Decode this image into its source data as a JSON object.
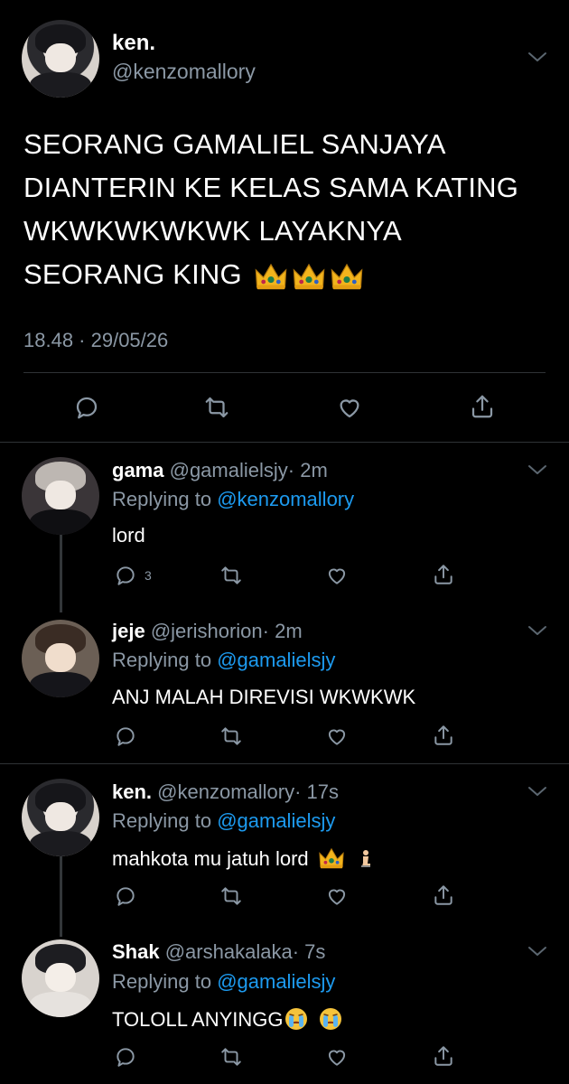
{
  "main": {
    "name": "ken.",
    "handle": "@kenzomallory",
    "text": "SEORANG GAMALIEL SANJAYA DIANTERIN KE KELAS SAMA KATING WKWKWKWKWK LAYAKNYA SEORANG KING",
    "emoji": [
      "crown",
      "crown",
      "crown"
    ],
    "time": "18.48 · 29/05/26"
  },
  "replies": [
    {
      "name": "gama",
      "handle": "@gamalielsjy",
      "age": "· 2m",
      "replying_prefix": "Replying to ",
      "replying_to": "@kenzomallory",
      "text": "lord",
      "reply_count": "3"
    },
    {
      "name": "jeje",
      "handle": "@jerishorion",
      "age": "· 2m",
      "replying_prefix": "Replying to ",
      "replying_to": "@gamalielsjy",
      "text": "ANJ MALAH DIREVISI WKWKWK",
      "reply_count": ""
    },
    {
      "name": "ken.",
      "handle": "@kenzomallory",
      "age": "· 17s",
      "replying_prefix": "Replying to ",
      "replying_to": "@gamalielsjy",
      "text": "mahkota mu jatuh lord",
      "reply_count": ""
    },
    {
      "name": "Shak",
      "handle": "@arshakalaka",
      "age": "· 7s",
      "replying_prefix": "Replying to ",
      "replying_to": "@gamalielsjy",
      "text": "TOLOLL ANYINGG",
      "reply_count": ""
    }
  ],
  "icons": [
    "chevron-down-icon",
    "reply-icon",
    "retweet-icon",
    "like-icon",
    "share-icon",
    "crown-icon",
    "kneeling-person-icon",
    "crying-face-icon"
  ],
  "colors": {
    "background": "#000000",
    "text": "#ffffff",
    "secondary": "#8b98a5",
    "link": "#1d9bf0"
  }
}
